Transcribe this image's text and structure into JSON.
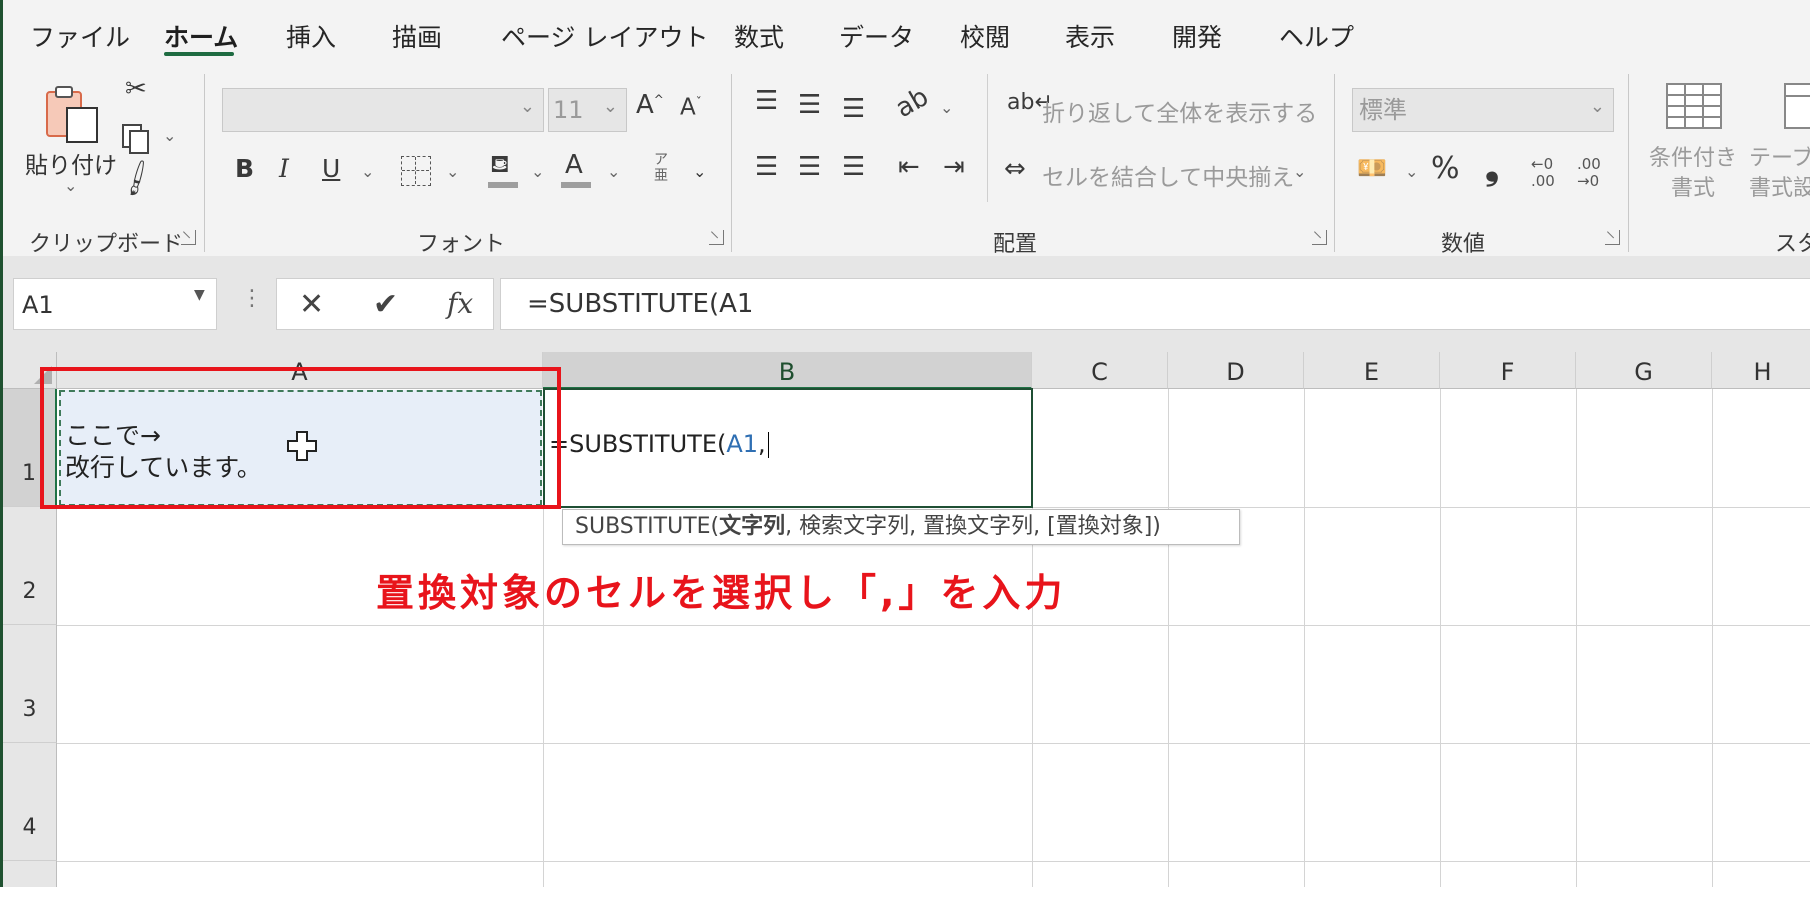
{
  "menu": {
    "tabs": [
      "ファイル",
      "ホーム",
      "挿入",
      "描画",
      "ページ レイアウト",
      "数式",
      "データ",
      "校閲",
      "表示",
      "開発",
      "ヘルプ"
    ],
    "active": "ホーム"
  },
  "clipboard": {
    "paste_label": "貼り付け",
    "group": "クリップボード"
  },
  "font": {
    "name_value": "",
    "size_value": "11",
    "group": "フォント",
    "bold": "B",
    "italic": "I",
    "underline": "U",
    "font_color": "A",
    "phonetic": "ア\n亜"
  },
  "alignment": {
    "wrap_text": "折り返して全体を表示する",
    "merge_center": "セルを結合して中央揃え",
    "group": "配置"
  },
  "number": {
    "format_value": "標準",
    "group": "数値",
    "percent": "%",
    "comma": "❟",
    "inc_decimal": "←0\n.00",
    "dec_decimal": ".00\n→0"
  },
  "styles": {
    "conditional": "条件付き\n書式",
    "table": "テーブル\n書式設",
    "group": "スタ"
  },
  "formula_bar": {
    "name_box": "A1",
    "fx": "fx",
    "formula": "=SUBSTITUTE(A1"
  },
  "grid": {
    "columns": [
      "A",
      "B",
      "C",
      "D",
      "E",
      "F",
      "G",
      "H"
    ],
    "selected_column": "B",
    "rows": [
      "1",
      "2",
      "3",
      "4"
    ],
    "cell_a1_line1": "ここで→",
    "cell_a1_line2": "改行しています。",
    "cell_b1_edit": "=SUBSTITUTE(A1,",
    "cell_b1_prefix": "=SUBSTITUTE(",
    "cell_b1_ref": "A1",
    "cell_b1_comma": ","
  },
  "tooltip": {
    "func": "SUBSTITUTE(",
    "arg1": "文字列",
    "rest": ", 検索文字列, 置換文字列, [置換対象])"
  },
  "annotation": {
    "text": "置換対象のセルを選択し「,」を入力",
    "color": "#e8141b"
  }
}
